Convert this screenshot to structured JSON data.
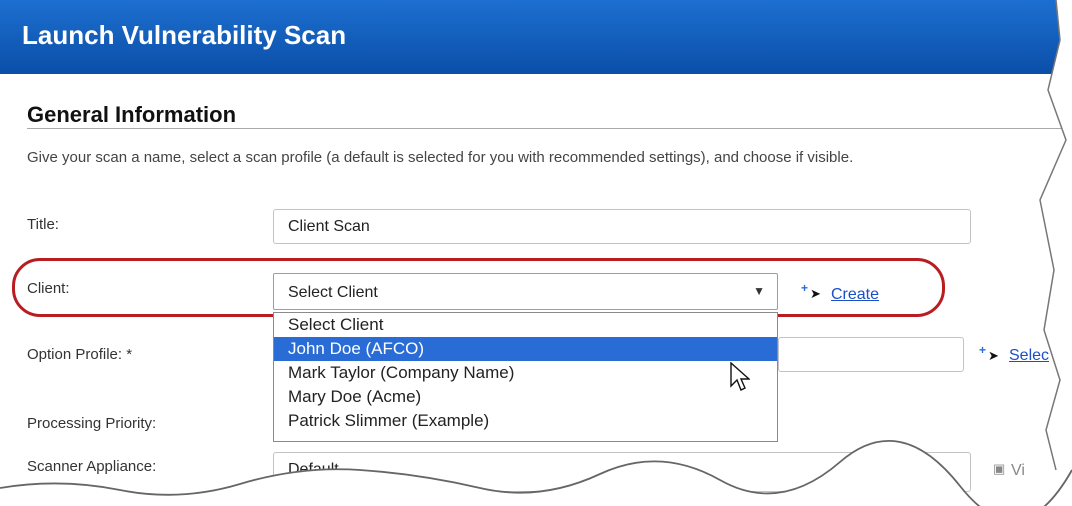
{
  "header": {
    "title": "Launch Vulnerability Scan"
  },
  "section": {
    "title": "General Information",
    "description": "Give your scan a name, select a scan profile (a default is selected for you with recommended settings), and choose if visible."
  },
  "form": {
    "title_label": "Title:",
    "title_value": "Client Scan",
    "client_label": "Client:",
    "client_value": "Select Client",
    "create_link": "Create",
    "option_profile_label": "Option Profile: *",
    "select_link": "Selec",
    "processing_priority_label": "Processing Priority:",
    "scanner_appliance_label": "Scanner Appliance:",
    "scanner_appliance_value": "Default",
    "view_link": "Vi"
  },
  "client_dropdown": {
    "options": [
      "Select Client",
      "John Doe (AFCO)",
      "Mark Taylor (Company Name)",
      "Mary Doe (Acme)",
      "Patrick Slimmer (Example)"
    ],
    "highlighted_index": 1
  },
  "colors": {
    "header": "#0a4fa8",
    "highlight_oval": "#b81d22",
    "selected_option": "#2a6cd6",
    "link": "#1a4fc6"
  }
}
